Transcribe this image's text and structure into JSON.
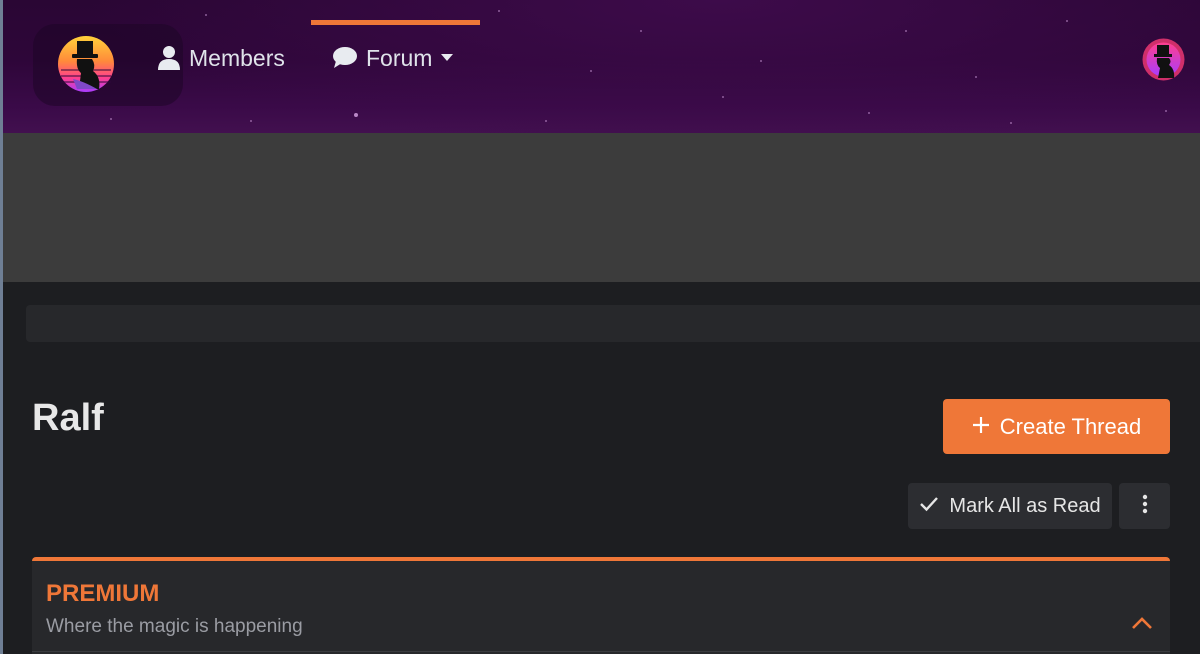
{
  "nav": {
    "members_label": "Members",
    "forum_label": "Forum",
    "active_item": "forum"
  },
  "page": {
    "title": "Ralf"
  },
  "actions": {
    "create_thread_label": "Create Thread",
    "mark_all_read_label": "Mark All as Read"
  },
  "category": {
    "title": "PREMIUM",
    "description": "Where the magic is happening"
  },
  "icons": {
    "logo": "magician-logo-icon",
    "members": "user-icon",
    "forum": "speech-bubble-icon",
    "forum_caret": "caret-down-icon",
    "create": "plus-icon",
    "mark": "check-icon",
    "more": "vertical-dots-icon",
    "collapse": "chevron-up-icon"
  },
  "colors": {
    "accent": "#ef7738",
    "background": "#1d1e21",
    "header_purple": "#2e0639",
    "card": "#27282b"
  }
}
